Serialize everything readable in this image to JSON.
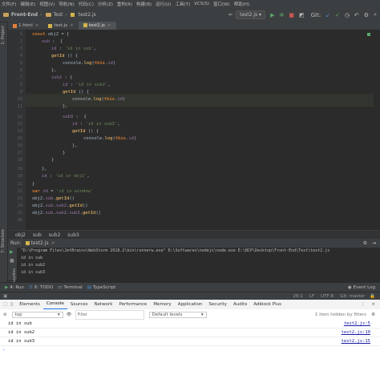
{
  "menu": [
    "文件(F)",
    "编辑(E)",
    "视图(V)",
    "导航(N)",
    "代码(C)",
    "分析(Z)",
    "重构(R)",
    "构建(B)",
    "运行(U)",
    "工具(T)",
    "VCS(S)",
    "窗口(W)",
    "帮助(H)"
  ],
  "nav": {
    "project": "Front-End",
    "folder": "Test",
    "file": "test2.js",
    "run_config": "test2.js",
    "git_label": "Git:"
  },
  "tabs": [
    {
      "label": "1.html",
      "type": "html",
      "active": false
    },
    {
      "label": "test.js",
      "type": "js",
      "active": false
    },
    {
      "label": "test2.js",
      "type": "js",
      "active": true
    }
  ],
  "side_tabs": {
    "project": "1: Project",
    "structure": "7: Structure",
    "favorites": "2: Favorites"
  },
  "gutter": [
    "1",
    "2",
    "3",
    "4",
    "5",
    "6",
    "7",
    "8",
    "9",
    "10",
    "11",
    "12",
    "13",
    "14",
    "15",
    "16",
    "17",
    "18",
    "19",
    "20",
    "21",
    "22",
    "23",
    "24",
    "25",
    "26"
  ],
  "breadcrumb": [
    "obj2",
    "sub",
    "sub2",
    "sub3"
  ],
  "run": {
    "label": "Run:",
    "config": "test2.js"
  },
  "console_lines": [
    "\"D:\\Program Files\\JetBrains\\WebStorm 2018.2\\bin\\runnerw.exe\" D:\\Softwares\\nodejs\\node.exe E:\\BCP\\Desktop\\Front-End\\Test\\test2.js",
    "id in sub",
    "id in sub2",
    "id in sub3"
  ],
  "tool_tabs": {
    "run": "4: Run",
    "todo": "6: TODO",
    "terminal": "Terminal",
    "typescript": "TypeScript",
    "event_log": "Event Log"
  },
  "status": {
    "position": "26:1",
    "line_sep": "LF",
    "encoding": "UTF-8",
    "git": "Git: master"
  },
  "devtools": {
    "tabs": [
      "Elements",
      "Console",
      "Sources",
      "Network",
      "Performance",
      "Memory",
      "Application",
      "Security",
      "Audits",
      "Adblock Plus"
    ],
    "active_tab": "Console",
    "context": "top",
    "filter_placeholder": "Filter",
    "levels": "Default levels",
    "hidden": "1 item hidden by filters",
    "logs": [
      {
        "text": "id in sub",
        "source": "test2.js:5"
      },
      {
        "text": "id in sub2",
        "source": "test2.js:10"
      },
      {
        "text": "id in sub3",
        "source": "test2.js:15"
      }
    ]
  },
  "colors": {
    "keyword": "#cc7832",
    "string": "#6a8759",
    "function": "#ffc66d",
    "property": "#9876aa"
  }
}
